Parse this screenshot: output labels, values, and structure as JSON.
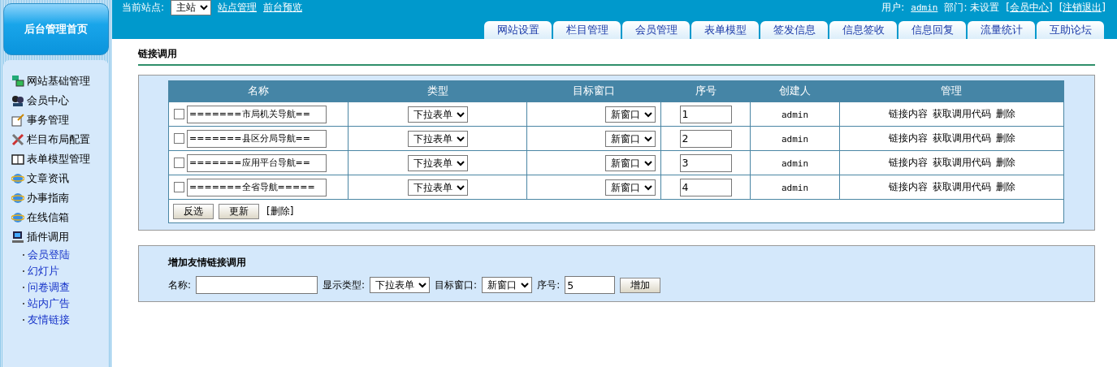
{
  "logo": {
    "label": "后台管理首页"
  },
  "topbar": {
    "site_label": "当前站点:",
    "site_value": "主站",
    "links": [
      "站点管理",
      "前台预览"
    ],
    "user_label": "用户:",
    "user": "admin",
    "dept": "部门: 未设置",
    "member_center": "[会员中心]",
    "logout": "[注销退出]"
  },
  "tabs": [
    "网站设置",
    "栏目管理",
    "会员管理",
    "表单模型",
    "签发信息",
    "信息签收",
    "信息回复",
    "流量统计",
    "互助论坛"
  ],
  "sidebar": {
    "items": [
      {
        "label": "网站基础管理",
        "kind": "network"
      },
      {
        "label": "会员中心",
        "kind": "people"
      },
      {
        "label": "事务管理",
        "kind": "notepad"
      },
      {
        "label": "栏目布局配置",
        "kind": "tools"
      },
      {
        "label": "表单模型管理",
        "kind": "book"
      },
      {
        "label": "文章资讯",
        "kind": "globe"
      },
      {
        "label": "办事指南",
        "kind": "globe"
      },
      {
        "label": "在线信箱",
        "kind": "globe"
      },
      {
        "label": "插件调用",
        "kind": "computer",
        "children": [
          {
            "label": "会员登陆"
          },
          {
            "label": "幻灯片"
          },
          {
            "label": "问卷调查"
          },
          {
            "label": "站内广告"
          },
          {
            "label": "友情链接"
          }
        ]
      }
    ]
  },
  "page_title": "链接调用",
  "table": {
    "columns": [
      "名称",
      "类型",
      "目标窗口",
      "序号",
      "创建人",
      "管理"
    ],
    "rows": [
      {
        "checked": false,
        "name": "=======市局机关导航==",
        "type": "下拉表单",
        "target": "新窗口",
        "order": "1",
        "creator": "admin",
        "actions": [
          "链接内容",
          "获取调用代码",
          "删除"
        ]
      },
      {
        "checked": false,
        "name": "=======县区分局导航==",
        "type": "下拉表单",
        "target": "新窗口",
        "order": "2",
        "creator": "admin",
        "actions": [
          "链接内容",
          "获取调用代码",
          "删除"
        ]
      },
      {
        "checked": false,
        "name": "=======应用平台导航==",
        "type": "下拉表单",
        "target": "新窗口",
        "order": "3",
        "creator": "admin",
        "actions": [
          "链接内容",
          "获取调用代码",
          "删除"
        ]
      },
      {
        "checked": false,
        "name": "=======全省导航=====",
        "type": "下拉表单",
        "target": "新窗口",
        "order": "4",
        "creator": "admin",
        "actions": [
          "链接内容",
          "获取调用代码",
          "删除"
        ]
      }
    ],
    "buttons": [
      "反选",
      "更新"
    ],
    "delete_link": "[删除]"
  },
  "add_form": {
    "title": "增加友情链接调用",
    "name_label": "名称:",
    "type_label": "显示类型:",
    "type_value": "下拉表单",
    "target_label": "目标窗口:",
    "target_value": "新窗口",
    "order_label": "序号:",
    "order_value": "5",
    "submit": "增加"
  }
}
